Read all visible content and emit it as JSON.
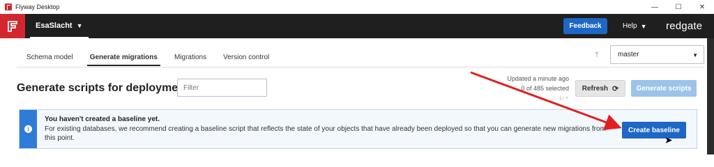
{
  "window": {
    "title": "Flyway Desktop",
    "controls": {
      "minimize": "—",
      "maximize": "☐",
      "close": "✕"
    }
  },
  "appbar": {
    "project_name": "EsaSlacht",
    "feedback_label": "Feedback",
    "help_label": "Help",
    "brand": "redgate"
  },
  "tabs": [
    {
      "label": "Schema model"
    },
    {
      "label": "Generate migrations"
    },
    {
      "label": "Migrations"
    },
    {
      "label": "Version control"
    }
  ],
  "branch": {
    "value": "master"
  },
  "main": {
    "title": "Generate scripts for deployment",
    "filter_placeholder": "Filter",
    "updated_text": "Updated a minute ago",
    "selected_text": "0 of 485 selected",
    "refresh_label": "Refresh",
    "generate_label": "Generate scripts"
  },
  "banner": {
    "title": "You haven't created a baseline yet.",
    "text": "For existing databases, we recommend creating a baseline script that reflects the state of your objects that have already been deployed so that you can generate new migrations from this point.",
    "button_label": "Create baseline"
  },
  "colors": {
    "accent": "#1e67c6",
    "brand_red": "#d4262e",
    "appbar_bg": "#1f1f1f",
    "banner_side": "#2f7bd8",
    "annotation_arrow": "#e0201f"
  }
}
